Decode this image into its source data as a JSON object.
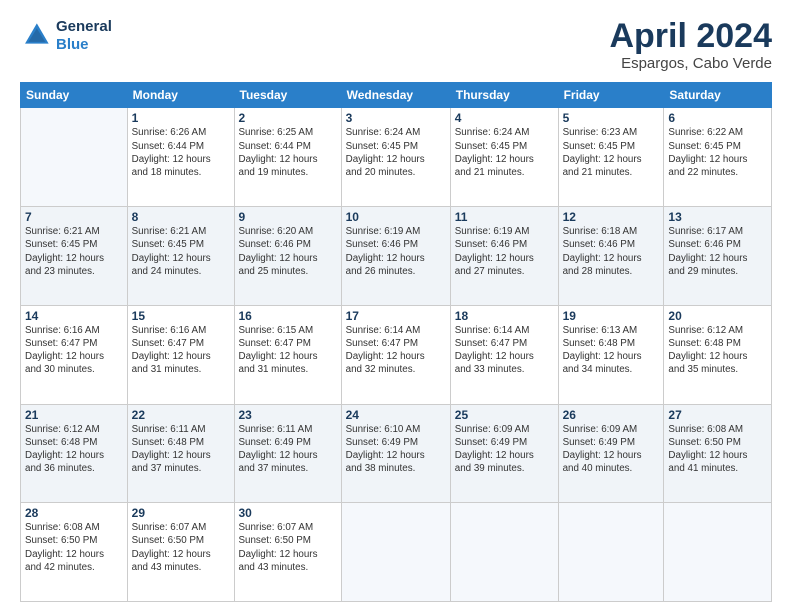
{
  "header": {
    "logo_line1": "General",
    "logo_line2": "Blue",
    "title": "April 2024",
    "subtitle": "Espargos, Cabo Verde"
  },
  "days_of_week": [
    "Sunday",
    "Monday",
    "Tuesday",
    "Wednesday",
    "Thursday",
    "Friday",
    "Saturday"
  ],
  "weeks": [
    [
      {
        "day": "",
        "info": ""
      },
      {
        "day": "1",
        "info": "Sunrise: 6:26 AM\nSunset: 6:44 PM\nDaylight: 12 hours\nand 18 minutes."
      },
      {
        "day": "2",
        "info": "Sunrise: 6:25 AM\nSunset: 6:44 PM\nDaylight: 12 hours\nand 19 minutes."
      },
      {
        "day": "3",
        "info": "Sunrise: 6:24 AM\nSunset: 6:45 PM\nDaylight: 12 hours\nand 20 minutes."
      },
      {
        "day": "4",
        "info": "Sunrise: 6:24 AM\nSunset: 6:45 PM\nDaylight: 12 hours\nand 21 minutes."
      },
      {
        "day": "5",
        "info": "Sunrise: 6:23 AM\nSunset: 6:45 PM\nDaylight: 12 hours\nand 21 minutes."
      },
      {
        "day": "6",
        "info": "Sunrise: 6:22 AM\nSunset: 6:45 PM\nDaylight: 12 hours\nand 22 minutes."
      }
    ],
    [
      {
        "day": "7",
        "info": "Sunrise: 6:21 AM\nSunset: 6:45 PM\nDaylight: 12 hours\nand 23 minutes."
      },
      {
        "day": "8",
        "info": "Sunrise: 6:21 AM\nSunset: 6:45 PM\nDaylight: 12 hours\nand 24 minutes."
      },
      {
        "day": "9",
        "info": "Sunrise: 6:20 AM\nSunset: 6:46 PM\nDaylight: 12 hours\nand 25 minutes."
      },
      {
        "day": "10",
        "info": "Sunrise: 6:19 AM\nSunset: 6:46 PM\nDaylight: 12 hours\nand 26 minutes."
      },
      {
        "day": "11",
        "info": "Sunrise: 6:19 AM\nSunset: 6:46 PM\nDaylight: 12 hours\nand 27 minutes."
      },
      {
        "day": "12",
        "info": "Sunrise: 6:18 AM\nSunset: 6:46 PM\nDaylight: 12 hours\nand 28 minutes."
      },
      {
        "day": "13",
        "info": "Sunrise: 6:17 AM\nSunset: 6:46 PM\nDaylight: 12 hours\nand 29 minutes."
      }
    ],
    [
      {
        "day": "14",
        "info": "Sunrise: 6:16 AM\nSunset: 6:47 PM\nDaylight: 12 hours\nand 30 minutes."
      },
      {
        "day": "15",
        "info": "Sunrise: 6:16 AM\nSunset: 6:47 PM\nDaylight: 12 hours\nand 31 minutes."
      },
      {
        "day": "16",
        "info": "Sunrise: 6:15 AM\nSunset: 6:47 PM\nDaylight: 12 hours\nand 31 minutes."
      },
      {
        "day": "17",
        "info": "Sunrise: 6:14 AM\nSunset: 6:47 PM\nDaylight: 12 hours\nand 32 minutes."
      },
      {
        "day": "18",
        "info": "Sunrise: 6:14 AM\nSunset: 6:47 PM\nDaylight: 12 hours\nand 33 minutes."
      },
      {
        "day": "19",
        "info": "Sunrise: 6:13 AM\nSunset: 6:48 PM\nDaylight: 12 hours\nand 34 minutes."
      },
      {
        "day": "20",
        "info": "Sunrise: 6:12 AM\nSunset: 6:48 PM\nDaylight: 12 hours\nand 35 minutes."
      }
    ],
    [
      {
        "day": "21",
        "info": "Sunrise: 6:12 AM\nSunset: 6:48 PM\nDaylight: 12 hours\nand 36 minutes."
      },
      {
        "day": "22",
        "info": "Sunrise: 6:11 AM\nSunset: 6:48 PM\nDaylight: 12 hours\nand 37 minutes."
      },
      {
        "day": "23",
        "info": "Sunrise: 6:11 AM\nSunset: 6:49 PM\nDaylight: 12 hours\nand 37 minutes."
      },
      {
        "day": "24",
        "info": "Sunrise: 6:10 AM\nSunset: 6:49 PM\nDaylight: 12 hours\nand 38 minutes."
      },
      {
        "day": "25",
        "info": "Sunrise: 6:09 AM\nSunset: 6:49 PM\nDaylight: 12 hours\nand 39 minutes."
      },
      {
        "day": "26",
        "info": "Sunrise: 6:09 AM\nSunset: 6:49 PM\nDaylight: 12 hours\nand 40 minutes."
      },
      {
        "day": "27",
        "info": "Sunrise: 6:08 AM\nSunset: 6:50 PM\nDaylight: 12 hours\nand 41 minutes."
      }
    ],
    [
      {
        "day": "28",
        "info": "Sunrise: 6:08 AM\nSunset: 6:50 PM\nDaylight: 12 hours\nand 42 minutes."
      },
      {
        "day": "29",
        "info": "Sunrise: 6:07 AM\nSunset: 6:50 PM\nDaylight: 12 hours\nand 43 minutes."
      },
      {
        "day": "30",
        "info": "Sunrise: 6:07 AM\nSunset: 6:50 PM\nDaylight: 12 hours\nand 43 minutes."
      },
      {
        "day": "",
        "info": ""
      },
      {
        "day": "",
        "info": ""
      },
      {
        "day": "",
        "info": ""
      },
      {
        "day": "",
        "info": ""
      }
    ]
  ]
}
